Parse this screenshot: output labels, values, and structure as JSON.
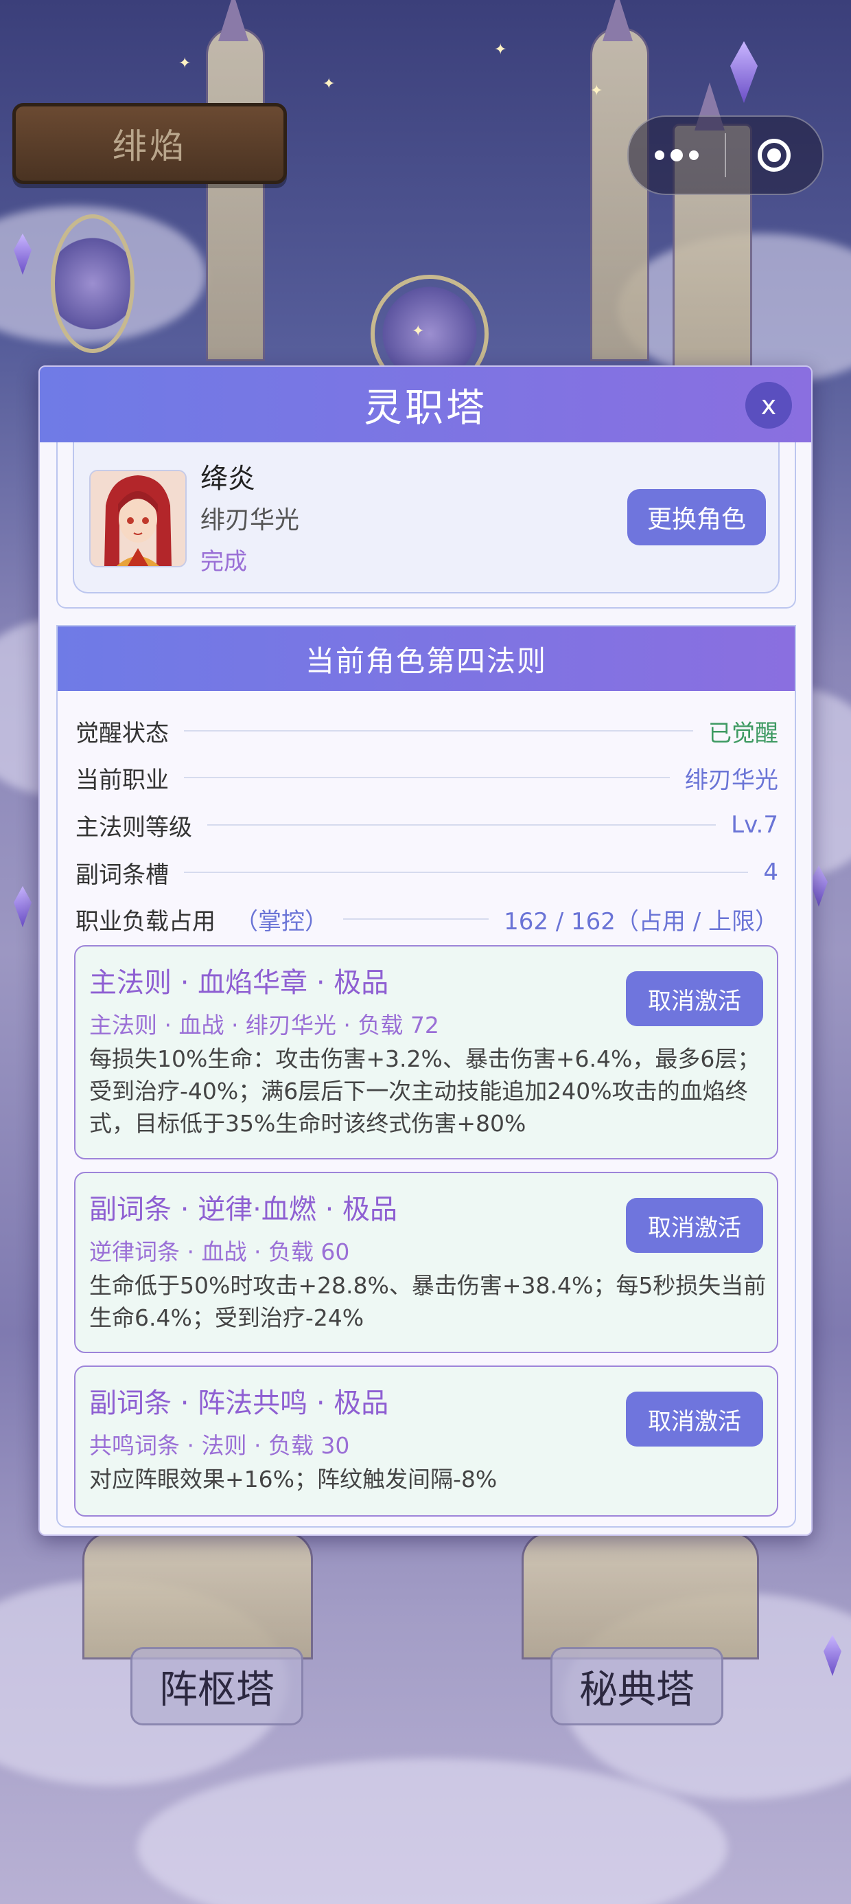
{
  "top_bar": {
    "game_title": "绯焰"
  },
  "modal": {
    "title": "灵职塔",
    "close_label": "x",
    "character": {
      "name": "绛炎",
      "class": "绯刃华光",
      "status": "完成",
      "swap_label": "更换角色"
    },
    "law_panel": {
      "title": "当前角色第四法则",
      "stats": [
        {
          "label": "觉醒状态",
          "value": "已觉醒",
          "color": "#3e9a62"
        },
        {
          "label": "当前职业",
          "value": "绯刃华光",
          "color": "#6a74d6"
        },
        {
          "label": "主法则等级",
          "value": "Lv.7",
          "color": "#6a74d6"
        },
        {
          "label": "副词条槽",
          "value": "4",
          "color": "#6a74d6"
        }
      ],
      "load": {
        "label": "职业负载占用",
        "hint": "（掌控）",
        "value": "162 / 162（占用 / 上限）"
      },
      "entries": [
        {
          "title": "主法则 · 血焰华章 · 极品",
          "subtitle": "主法则 · 血战 · 绯刃华光 · 负载 72",
          "description": "每损失10%生命：攻击伤害+3.2%、暴击伤害+6.4%，最多6层；受到治疗-40%；满6层后下一次主动技能追加240%攻击的血焰终式，目标低于35%生命时该终式伤害+80%",
          "button": "取消激活"
        },
        {
          "title": "副词条 · 逆律·血燃 · 极品",
          "subtitle": "逆律词条 · 血战 · 负载 60",
          "description": "生命低于50%时攻击+28.8%、暴击伤害+38.4%；每5秒损失当前生命6.4%；受到治疗-24%",
          "button": "取消激活"
        },
        {
          "title": "副词条 · 阵法共鸣 · 极品",
          "subtitle": "共鸣词条 · 法则 · 负载 30",
          "description": "对应阵眼效果+16%；阵纹触发间隔-8%",
          "button": "取消激活"
        }
      ]
    }
  },
  "bottom": {
    "left_tower": "阵枢塔",
    "right_tower": "秘典塔"
  }
}
